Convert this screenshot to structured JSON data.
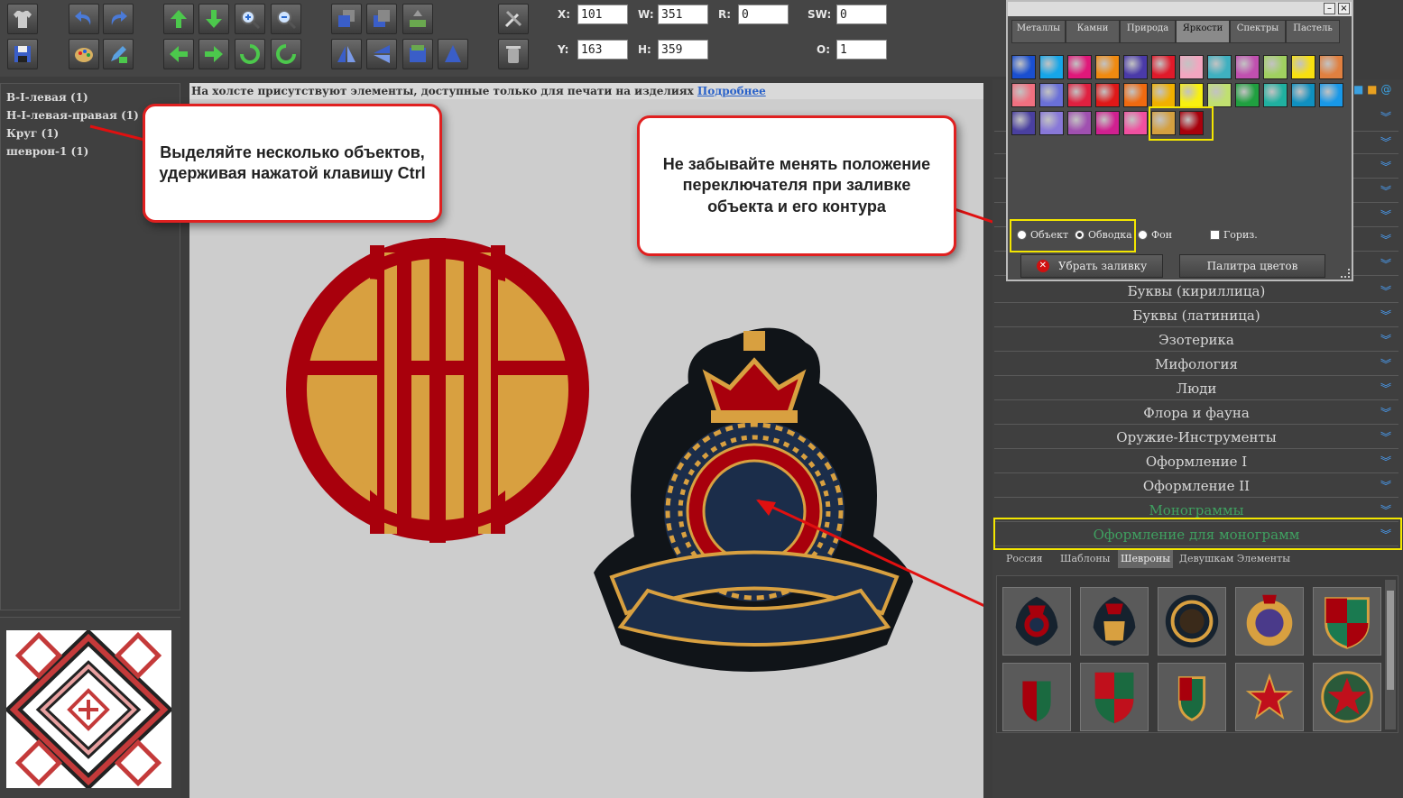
{
  "toolbar": {
    "coords": {
      "x_label": "X:",
      "x_value": "101",
      "y_label": "Y:",
      "y_value": "163",
      "w_label": "W:",
      "w_value": "351",
      "h_label": "H:",
      "h_value": "359",
      "r_label": "R:",
      "r_value": "0",
      "sw_label": "SW:",
      "sw_value": "0",
      "o_label": "O:",
      "o_value": "1"
    }
  },
  "object_list": {
    "items": [
      "В-I-левая (1)",
      "Н-I-левая-правая (1)",
      "Круг (1)",
      "шеврон-1 (1)"
    ]
  },
  "canvas": {
    "notice": "На холсте присутствуют элементы, доступные только для печати на изделиях",
    "notice_link": "Подробнее"
  },
  "callouts": {
    "left": "Выделяйте несколько объектов, удерживая нажатой клавишу Ctrl",
    "right": "Не забывайте менять положение переключателя при заливке объекта и его контура"
  },
  "palette": {
    "tabs": [
      "Металлы",
      "Камни",
      "Природа",
      "Яркости",
      "Спектры",
      "Пастель"
    ],
    "active_tab": "Яркости",
    "swatch_rows": [
      [
        "#1a4fd0",
        "#16a6e8",
        "#e0187a",
        "#f08a10",
        "#4a3aa8",
        "#e01a2a",
        "#f2a6c0",
        "#3fb0c0",
        "#c050b0",
        "#a0d060",
        "#f8e010",
        "#e08040"
      ],
      [
        "#f07080",
        "#6a70d8",
        "#e02040",
        "#e01818",
        "#f06a10",
        "#f0b000",
        "#f8f010",
        "#c0e070",
        "#20a040",
        "#20b0a0",
        "#1090c0",
        "#1898e8"
      ],
      [
        "#4a40a0",
        "#8878d8",
        "#a050b0",
        "#d02090",
        "#f050a0",
        "#d4a040",
        "#a8000c"
      ]
    ],
    "radio_object": "Объект",
    "radio_stroke": "Обводка",
    "radio_bg": "Фон",
    "checkbox_horiz": "Гориз.",
    "btn_remove_fill": "Убрать заливку",
    "btn_palette": "Палитра цветов"
  },
  "categories": [
    "Буквы (кириллица)",
    "Буквы (латиница)",
    "Эзотерика",
    "Мифология",
    "Люди",
    "Флора и фауна",
    "Оружие-Инструменты",
    "Оформление I",
    "Оформление II",
    "Монограммы",
    "Оформление для монограмм"
  ],
  "sub_tabs": [
    "Россия",
    "Шаблоны",
    "Шевроны",
    "Девушкам Элементы"
  ],
  "active_sub_tab": "Шевроны",
  "colors": {
    "monogram_gold": "#d8a040",
    "monogram_red": "#a8000c",
    "badge_navy": "#1b2d4a",
    "badge_black": "#101418",
    "highlight_yellow": "#f3e600",
    "callout_red": "#e02020"
  }
}
